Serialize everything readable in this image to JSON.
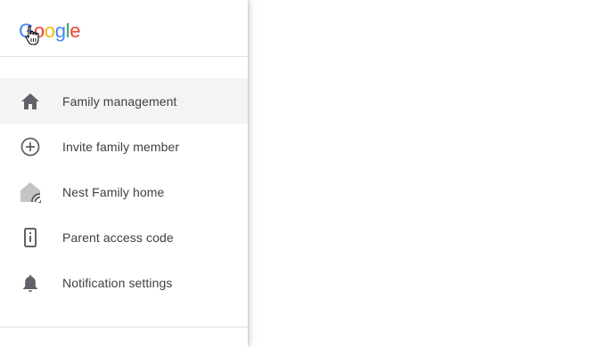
{
  "brand": {
    "logo_text": "Google",
    "logo_letters": [
      {
        "ch": "G",
        "color": "#4285F4"
      },
      {
        "ch": "o",
        "color": "#EA4335"
      },
      {
        "ch": "o",
        "color": "#FBBC05"
      },
      {
        "ch": "g",
        "color": "#4285F4"
      },
      {
        "ch": "l",
        "color": "#34A853"
      },
      {
        "ch": "e",
        "color": "#EA4335"
      }
    ]
  },
  "nav": {
    "items": [
      {
        "label": "Family management",
        "icon": "home-icon",
        "active": true
      },
      {
        "label": "Invite family member",
        "icon": "add-circle-icon",
        "active": false
      },
      {
        "label": "Nest Family home",
        "icon": "nest-home-icon",
        "active": false
      },
      {
        "label": "Parent access code",
        "icon": "phone-code-icon",
        "active": false
      },
      {
        "label": "Notification settings",
        "icon": "bell-icon",
        "active": false
      }
    ]
  },
  "colors": {
    "icon_gray": "#5f6368",
    "active_bg": "#f4f4f4",
    "text": "#3c4043"
  }
}
